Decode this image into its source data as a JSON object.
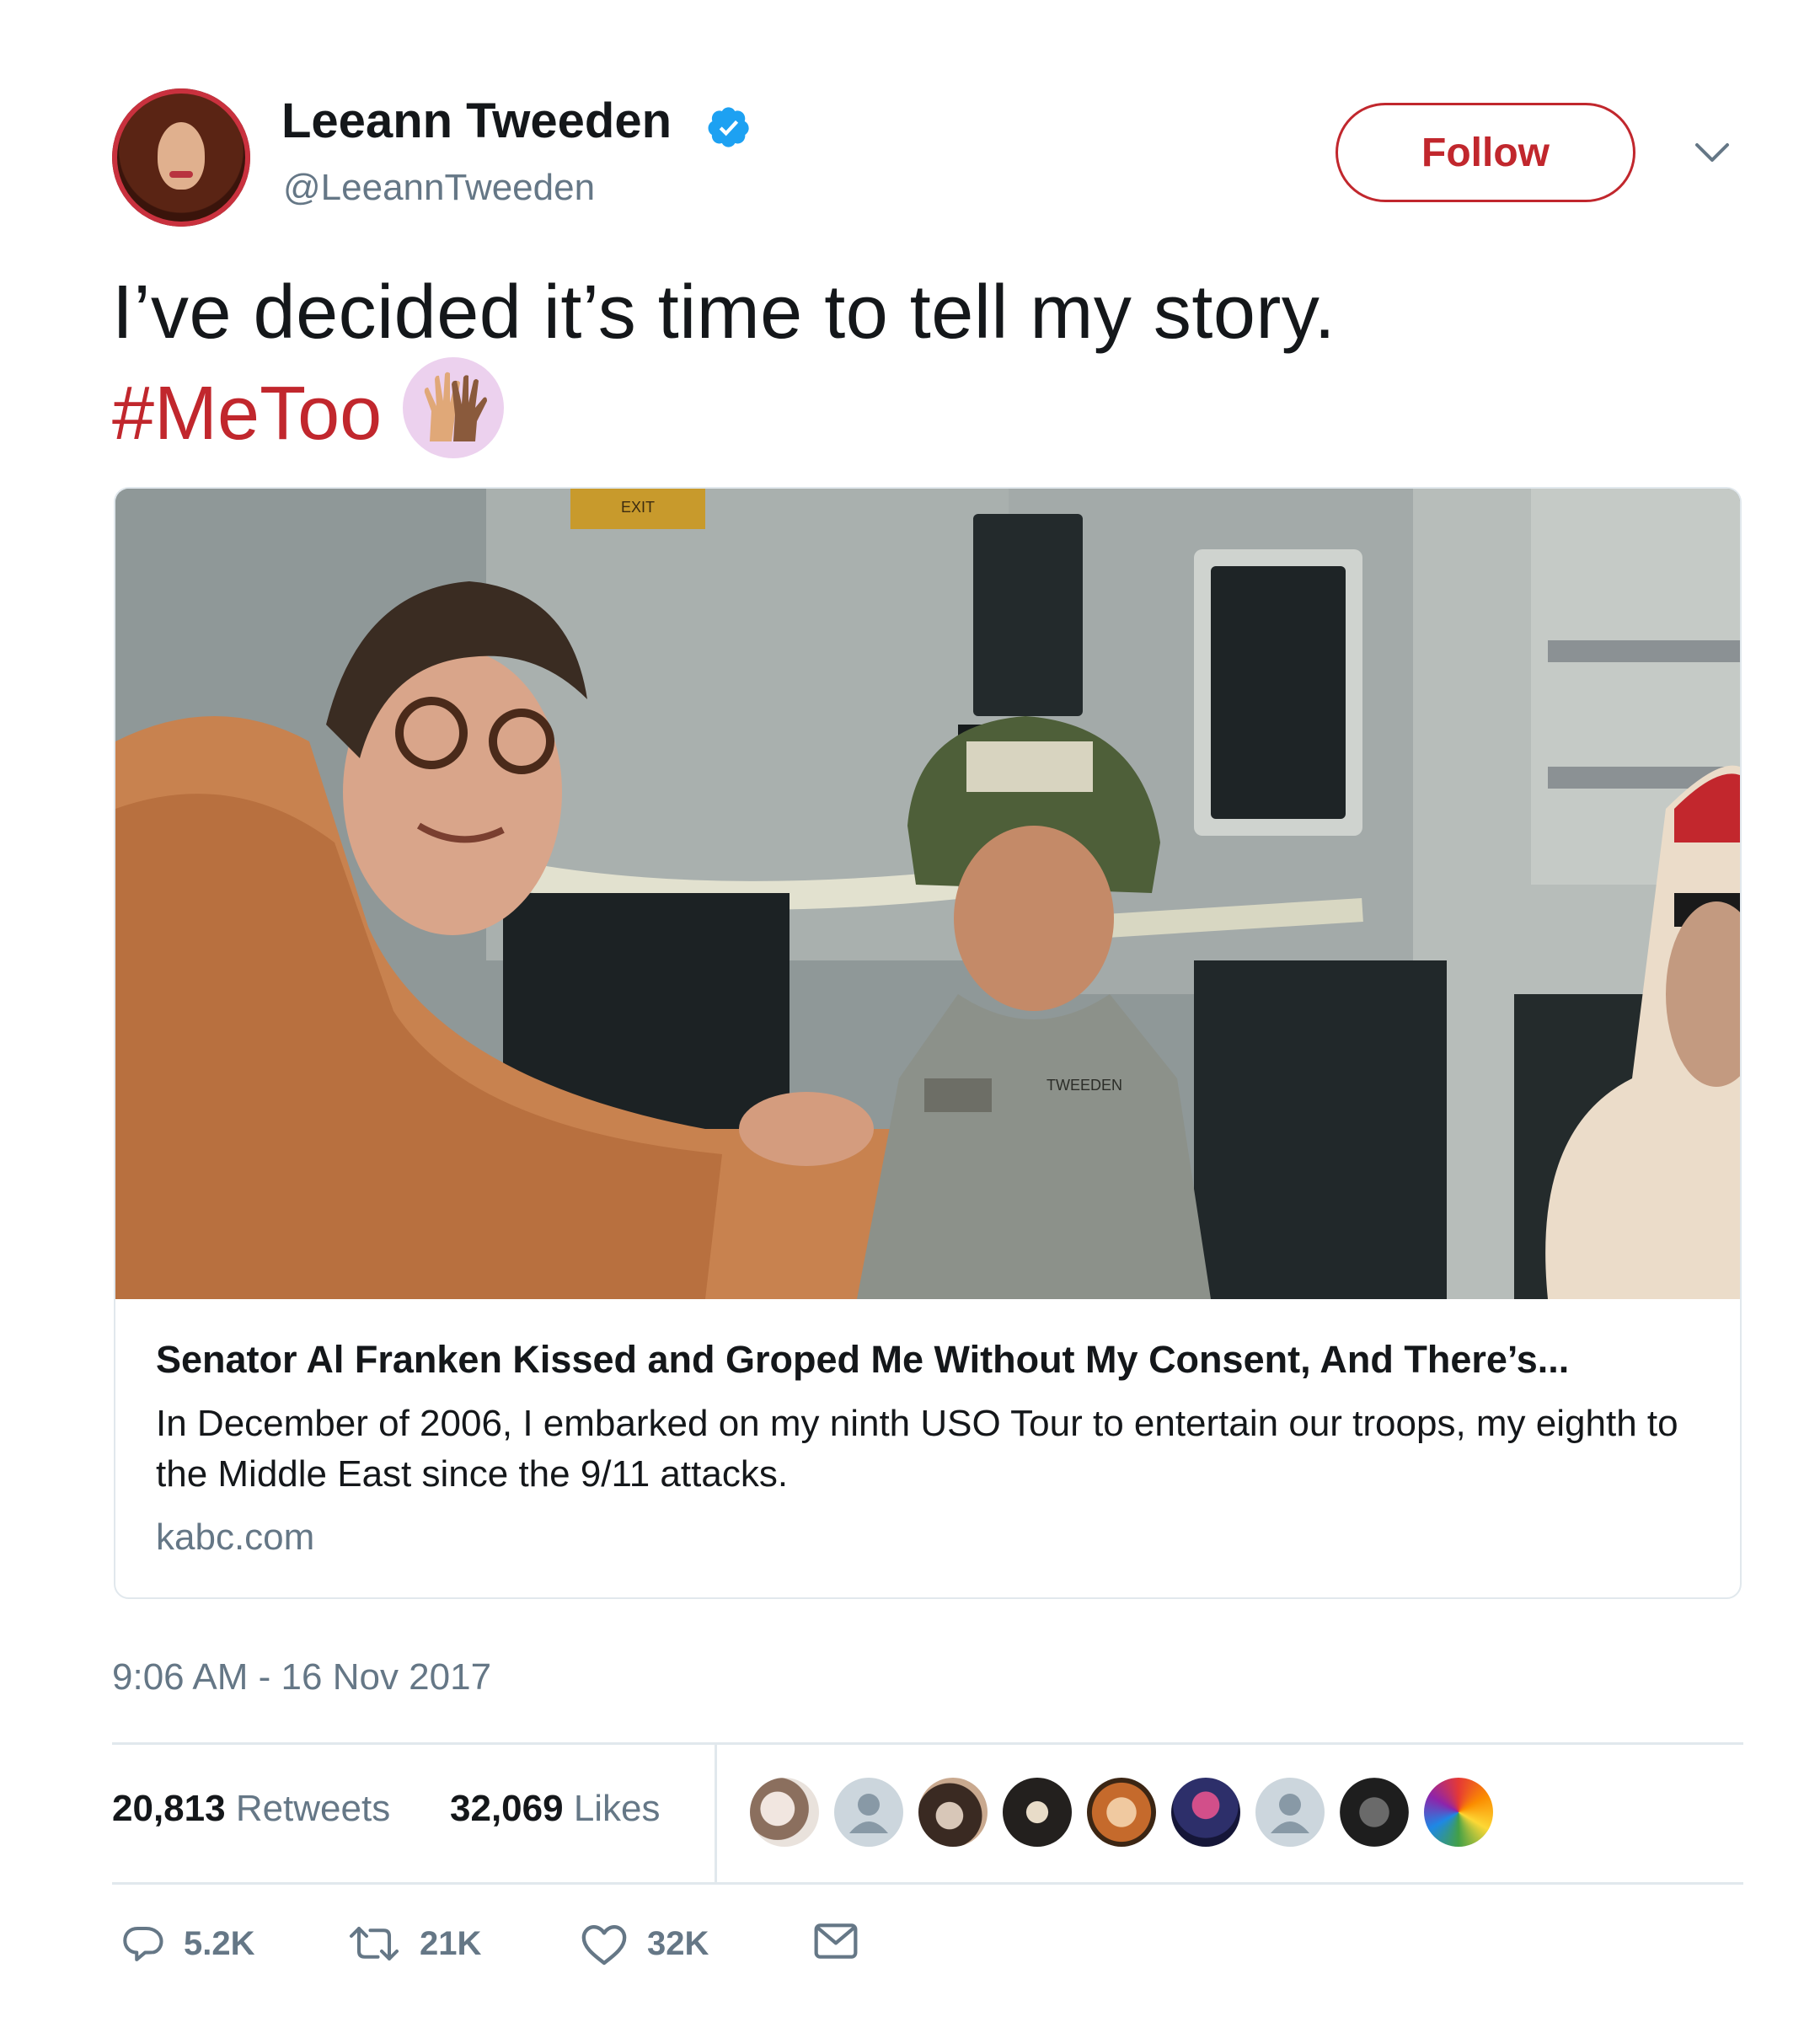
{
  "user": {
    "display_name": "Leeann Tweeden",
    "handle": "@LeeannTweeden",
    "verified": true,
    "verified_icon": "verified-badge-icon"
  },
  "header": {
    "follow_label": "Follow",
    "menu_icon": "chevron-down-icon"
  },
  "tweet": {
    "text": "I’ve decided it’s time to tell my story.",
    "hashtag": "#MeToo",
    "emoji": "raising-hands-emoji"
  },
  "card": {
    "title": "Senator Al Franken Kissed and Groped Me Without My Consent, And There’s...",
    "description": "In December of 2006, I embarked on my ninth USO Tour to entertain our troops, my eighth to the Middle East since the 9/11 attacks.",
    "domain": "kabc.com",
    "photo_labels": {
      "exit_sign": "EXIT",
      "name_tape": "TWEEDEN"
    }
  },
  "timestamp": "9:06 AM - 16 Nov 2017",
  "stats": {
    "retweets_count": "20,813",
    "retweets_label": "Retweets",
    "likes_count": "32,069",
    "likes_label": "Likes"
  },
  "likers": [
    "liker-avatar",
    "default-avatar",
    "liker-avatar",
    "liker-avatar",
    "liker-avatar",
    "liker-avatar",
    "default-avatar",
    "liker-avatar",
    "liker-avatar"
  ],
  "actions": {
    "reply_count": "5.2K",
    "retweet_count": "21K",
    "like_count": "32K"
  },
  "colors": {
    "accent_red": "#c1272d",
    "text": "#14171a",
    "muted": "#657786",
    "verified_blue": "#1da1f2",
    "border": "#e1e8ed"
  }
}
